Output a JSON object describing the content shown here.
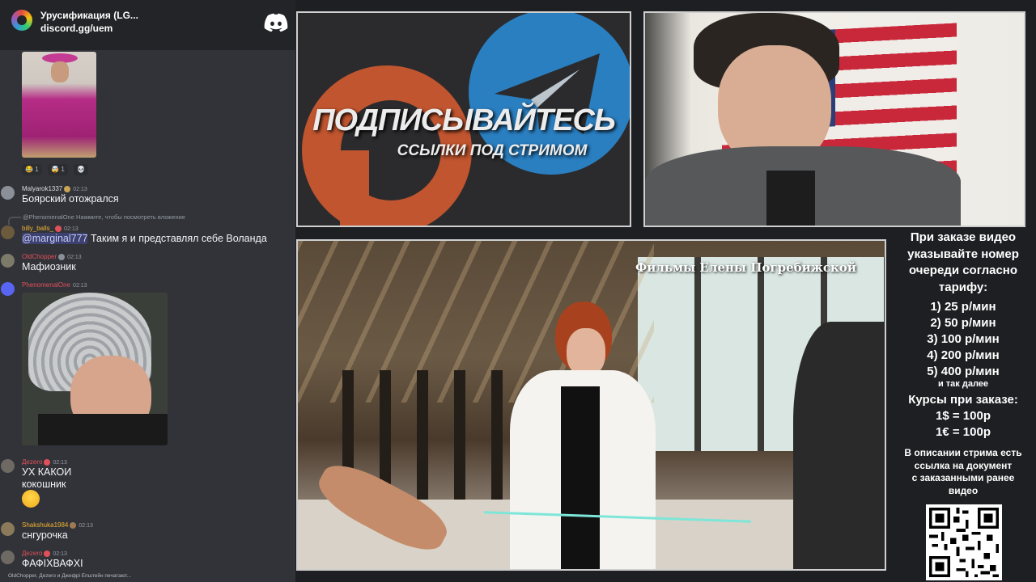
{
  "discord": {
    "server_name": "Урусификация (LG...",
    "invite": "discord.gg/uem",
    "reactions": [
      {
        "emoji": "😂",
        "count": "1"
      },
      {
        "emoji": "🤯",
        "count": "1"
      },
      {
        "emoji": "💀",
        "count": ""
      }
    ],
    "messages": [
      {
        "user": "Malyarok1337",
        "time": "02:13",
        "user_color": "#dcddde",
        "text": "Боярский отожрался"
      },
      {
        "reply_preview": "@PhenomenalOne Нажмите, чтобы посмотреть вложение",
        "user": "billy_balls_",
        "time": "02:13",
        "user_color": "#f0b232",
        "mention": "@marginal777",
        "text": "Таким я и представлял себе Воланда"
      },
      {
        "user": "OldChopper",
        "time": "02:13",
        "user_color": "#e0505b",
        "text": "Мафиозник"
      },
      {
        "user": "PhenomenalOne",
        "time": "02:13",
        "user_color": "#e0505b"
      },
      {
        "user": "Дezero",
        "time": "02:13",
        "user_color": "#e0505b",
        "text": "УХ КАКОИ",
        "text2": "кокошник"
      },
      {
        "user": "Shakshuka1984",
        "time": "02:13",
        "user_color": "#f0b232",
        "text": "снгурочка"
      },
      {
        "user": "Дezero",
        "time": "02:13",
        "user_color": "#e0505b",
        "text": "ФАФІХВАФХІ"
      }
    ],
    "typing": "OldChopper, Дezero и Джефрі Епштейн печатают..."
  },
  "promo": {
    "title": "ПОДПИСЫВАЙТЕСЬ",
    "subtitle": "ССЫЛКИ ПОД СТРИМОМ"
  },
  "video": {
    "watermark": "Фильмы Елены Погребижской"
  },
  "info": {
    "intro": [
      "При заказе видео",
      "указывайте номер",
      "очереди согласно",
      "тарифу:"
    ],
    "tariffs": [
      "1) 25 р/мин",
      "2) 50 р/мин",
      "3) 100 р/мин",
      "4) 200 р/мин",
      "5) 400 р/мин"
    ],
    "etc": "и так далее",
    "rates_title": "Курсы при заказе:",
    "rates": [
      "1$ = 100р",
      "1€ = 100р"
    ],
    "desc": [
      "В описании стрима есть",
      "ссылка на документ",
      "с заказанными ранее",
      "видео"
    ]
  }
}
